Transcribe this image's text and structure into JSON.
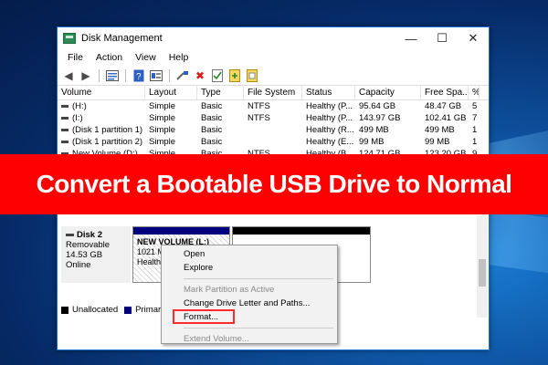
{
  "window": {
    "title": "Disk Management",
    "controls": {
      "minimize": "—",
      "maximize": "☐",
      "close": "✕"
    }
  },
  "menu": [
    "File",
    "Action",
    "View",
    "Help"
  ],
  "toolbar_icons": [
    "back-arrow-icon",
    "forward-arrow-icon",
    "disk-list-icon",
    "help-icon",
    "properties-icon",
    "connect-icon",
    "delete-icon",
    "check-icon",
    "add-icon",
    "refresh-icon"
  ],
  "table": {
    "headers": [
      "Volume",
      "Layout",
      "Type",
      "File System",
      "Status",
      "Capacity",
      "Free Spa...",
      "%"
    ],
    "rows": [
      [
        "(H:)",
        "Simple",
        "Basic",
        "NTFS",
        "Healthy (P...",
        "95.64 GB",
        "48.47 GB",
        "5"
      ],
      [
        "(I:)",
        "Simple",
        "Basic",
        "NTFS",
        "Healthy (P...",
        "143.97 GB",
        "102.41 GB",
        "7"
      ],
      [
        "(Disk 1 partition 1)",
        "Simple",
        "Basic",
        "",
        "Healthy (R...",
        "499 MB",
        "499 MB",
        "1"
      ],
      [
        "(Disk 1 partition 2)",
        "Simple",
        "Basic",
        "",
        "Healthy (E...",
        "99 MB",
        "99 MB",
        "1"
      ],
      [
        "New Volume (D:)",
        "Simple",
        "Basic",
        "NTFS",
        "Healthy (B...",
        "124.71 GB",
        "123.20 GB",
        "9"
      ]
    ]
  },
  "banner": {
    "text": "Convert a Bootable USB Drive to Normal"
  },
  "disk": {
    "name": "Disk 2",
    "type": "Removable",
    "size": "14.53 GB",
    "status": "Online",
    "partition": {
      "name": "NEW VOLUME (L:)",
      "size": "1021 M",
      "status": "Health"
    }
  },
  "legend": {
    "unallocated": "Unallocated",
    "primary": "Primary"
  },
  "context_menu": {
    "open": "Open",
    "explore": "Explore",
    "mark_active": "Mark Partition as Active",
    "change_letter": "Change Drive Letter and Paths...",
    "format": "Format...",
    "extend": "Extend Volume..."
  },
  "colors": {
    "banner": "#ff0000",
    "primary_partition": "#00007f",
    "unallocated": "#000000",
    "format_highlight": "#ff2a2a"
  }
}
